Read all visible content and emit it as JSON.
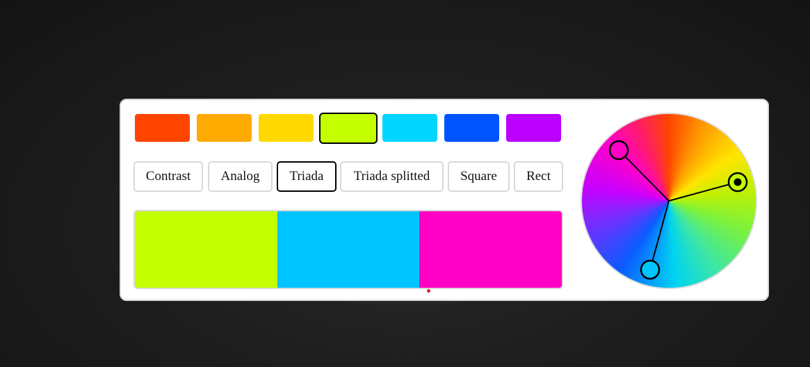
{
  "swatches": [
    {
      "name": "red-orange",
      "color": "#ff4400"
    },
    {
      "name": "orange",
      "color": "#ffaa00"
    },
    {
      "name": "yellow",
      "color": "#ffd800"
    },
    {
      "name": "lime",
      "color": "#c4ff00"
    },
    {
      "name": "cyan",
      "color": "#00d5ff"
    },
    {
      "name": "blue",
      "color": "#0055ff"
    },
    {
      "name": "purple",
      "color": "#bb00ff"
    }
  ],
  "selected_swatch": "lime",
  "modes": {
    "contrast": "Contrast",
    "analog": "Analog",
    "triada": "Triada",
    "triada_splitted": "Triada splitted",
    "square": "Square",
    "rect": "Rect"
  },
  "active_mode": "Triada",
  "palette": {
    "colors": [
      "#c4ff00",
      "#00c4ff",
      "#ff00c4"
    ]
  },
  "indicator_color": "#e0202a",
  "wheel": {
    "handles": [
      {
        "role": "primary",
        "color": "#c4ff00"
      },
      {
        "role": "secondary",
        "color": "#00c4ff"
      },
      {
        "role": "tertiary",
        "color": "#ff00c4"
      }
    ]
  }
}
